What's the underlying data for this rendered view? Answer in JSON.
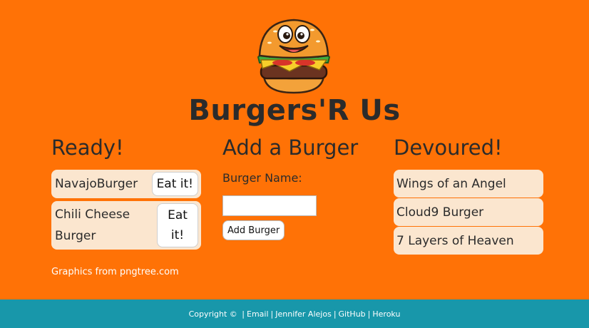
{
  "header": {
    "title": "Burgers'R Us"
  },
  "ready": {
    "heading": "Ready!",
    "items": [
      {
        "name": "NavajoBurger",
        "button": "Eat it!"
      },
      {
        "name": "Chili Cheese Burger",
        "button": "Eat it!"
      }
    ]
  },
  "add": {
    "heading": "Add a Burger",
    "label": "Burger Name:",
    "input_value": "",
    "button": "Add Burger"
  },
  "devoured": {
    "heading": "Devoured!",
    "items": [
      "Wings of an Angel",
      "Cloud9 Burger",
      "7 Layers of Heaven"
    ]
  },
  "credits": "Graphics from pngtree.com",
  "footer": {
    "copyright": "Copyright ©",
    "links": [
      "Email",
      "Jennifer Alejos",
      "GitHub",
      "Heroku"
    ]
  },
  "colors": {
    "background": "#ff7206",
    "card": "#fbe6cf",
    "footer": "#1897aa"
  },
  "icons": {
    "logo": "smiling-burger-icon"
  }
}
